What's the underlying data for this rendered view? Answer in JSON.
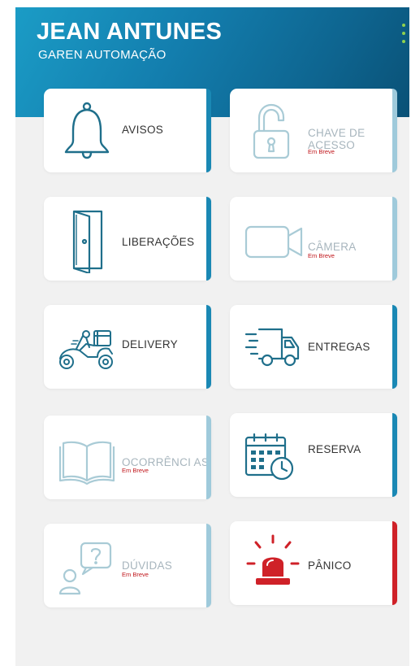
{
  "header": {
    "user_name": "JEAN ANTUNES",
    "company": "GAREN AUTOMAÇÃO",
    "menu_icon": "more-vertical-icon",
    "accent_color": "#8fd14f"
  },
  "coming_soon_label": "Em Breve",
  "colors": {
    "header_gradient": [
      "#1b9cc6",
      "#0a5176"
    ],
    "active_bar": "#1a88b4",
    "disabled_bar": "#9fcadb",
    "panic_bar": "#cf2128",
    "icon_active": "#1f6f8b",
    "icon_disabled": "#a9cbd6",
    "panic_icon": "#cf2128",
    "coming_soon_text": "#c0161b"
  },
  "tiles": [
    {
      "id": "avisos",
      "label": "AVISOS",
      "icon": "bell-icon",
      "enabled": true
    },
    {
      "id": "chave",
      "label_line1": "CHAVE DE",
      "label_line2": "ACESSO",
      "icon": "padlock-icon",
      "enabled": false,
      "coming_soon": true
    },
    {
      "id": "liberacoes",
      "label": "LIBERAÇÕES",
      "icon": "door-icon",
      "enabled": true
    },
    {
      "id": "camera",
      "label": "CÂMERA",
      "icon": "video-camera-icon",
      "enabled": false,
      "coming_soon": true
    },
    {
      "id": "delivery",
      "label": "DELIVERY",
      "icon": "delivery-scooter-icon",
      "enabled": true
    },
    {
      "id": "entregas",
      "label": "ENTREGAS",
      "icon": "delivery-truck-icon",
      "enabled": true
    },
    {
      "id": "ocorrencias",
      "label": "OCORRÊNCI AS",
      "icon": "open-book-icon",
      "enabled": false,
      "coming_soon": true
    },
    {
      "id": "reserva",
      "label": "RESERVA",
      "icon": "calendar-clock-icon",
      "enabled": true
    },
    {
      "id": "duvidas",
      "label": "DÚVIDAS",
      "icon": "question-chat-icon",
      "enabled": false,
      "coming_soon": true
    },
    {
      "id": "panico",
      "label": "PÂNICO",
      "icon": "siren-alarm-icon",
      "enabled": true
    }
  ]
}
